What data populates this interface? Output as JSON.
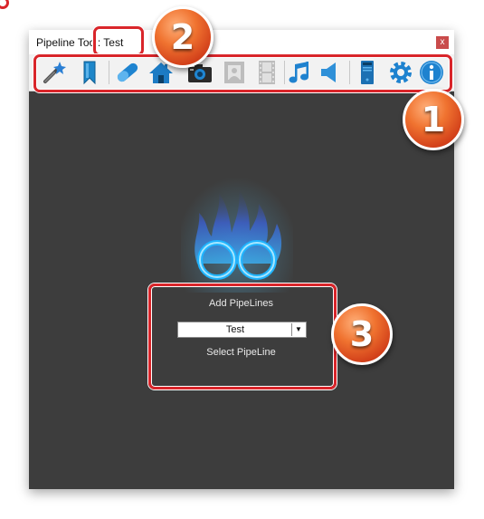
{
  "window": {
    "title": "Pipeline Tool: Test",
    "close_label": "x"
  },
  "toolbar": {
    "tools": [
      {
        "icon": "magic-wand-icon"
      },
      {
        "icon": "bookmark-icon"
      },
      {
        "icon": "pill-icon"
      },
      {
        "icon": "home-icon"
      },
      {
        "icon": "camera-icon"
      },
      {
        "icon": "photo-frame-icon"
      },
      {
        "icon": "film-strip-icon"
      },
      {
        "icon": "music-note-icon"
      },
      {
        "icon": "speaker-icon"
      },
      {
        "icon": "server-tower-icon"
      },
      {
        "icon": "gear-icon"
      },
      {
        "icon": "info-icon"
      }
    ]
  },
  "pipeline_panel": {
    "add_label": "Add PipeLines",
    "selected_value": "Test",
    "select_label": "Select PipeLine"
  },
  "callouts": {
    "one": "1",
    "two": "2",
    "three": "3"
  },
  "colors": {
    "highlight": "#d9252a",
    "badge": "#e85a24",
    "main_background": "#3d3d3d",
    "flame": "#2fb6ff"
  }
}
